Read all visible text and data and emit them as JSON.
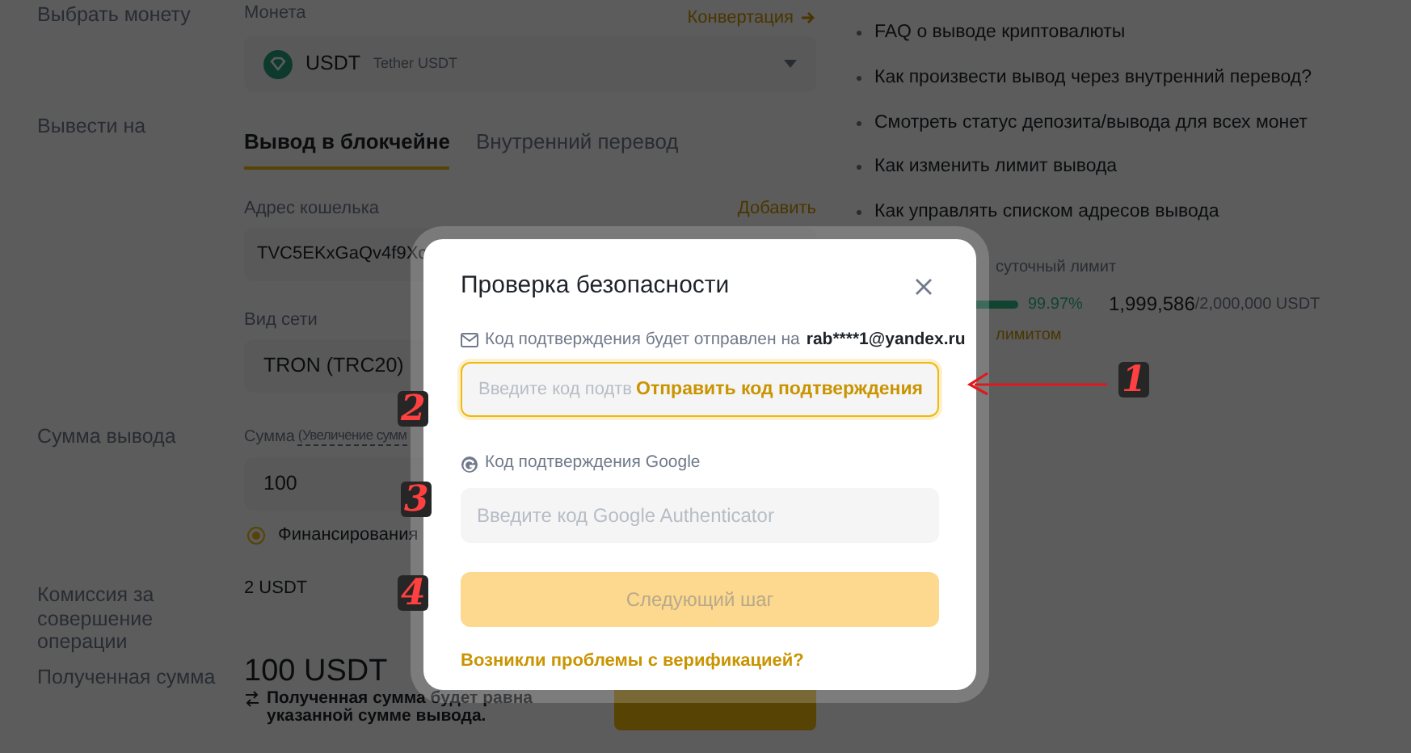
{
  "form": {
    "coin": {
      "label": "Выбрать монету",
      "field_label": "Монета",
      "link": "Конвертация",
      "symbol": "USDT",
      "name": "Tether USDT"
    },
    "destination": {
      "label": "Вывести на",
      "tabs": [
        {
          "label": "Вывод в блокчейне",
          "selected": true
        },
        {
          "label": "Внутренний перевод",
          "selected": false
        }
      ],
      "address_label": "Адрес кошелька",
      "address_link": "Добавить",
      "address": "TVC5EKxGaQv4f9Xc",
      "network_label": "Вид сети",
      "network": "TRON (TRC20)"
    },
    "amount": {
      "label": "Сумма вывода",
      "field_label": "Сумма",
      "field_hint": "(Увеличение сумм",
      "value": "100",
      "radio": {
        "label": "Финансирования",
        "checked": true
      }
    },
    "fee": {
      "label": "Комиссия за совершение операции",
      "value": "2 USDT"
    },
    "received": {
      "label": "Полученная сумма",
      "value": "100 USDT",
      "note": "Полученная сумма будет равна указанной сумме вывода."
    }
  },
  "faq": [
    "FAQ о выводе криптовалюты",
    "Как произвести вывод через внутренний перевод?",
    "Смотреть статус депозита/вывода для всех монет",
    "Как изменить лимит вывода",
    "Как управлять списком адресов вывода"
  ],
  "limit": {
    "label": "суточный лимит",
    "level": 0.9997,
    "percent": "99.97%",
    "used": "1,999,586",
    "total": "/2,000,000 USDT",
    "link": "лимитом"
  },
  "dialog": {
    "title": "Проверка безопасности",
    "email_note": "Код подтверждения будет отправлен на",
    "email": "rab****1@yandex.ru",
    "email_placeholder": "Введите код подтв",
    "send_code": "Отправить код подтверждения",
    "google_label": "Код подтверждения Google",
    "google_placeholder": "Введите код Google Authenticator",
    "next": {
      "label": "Следующий шаг",
      "disabled": true
    },
    "help_link": "Возникли проблемы с верификацией?"
  },
  "annotations": [
    {
      "text": "2",
      "kind": "number"
    },
    {
      "text": "1",
      "kind": "arrow"
    },
    {
      "text": "3",
      "kind": "number"
    },
    {
      "text": "4",
      "kind": "number"
    }
  ]
}
